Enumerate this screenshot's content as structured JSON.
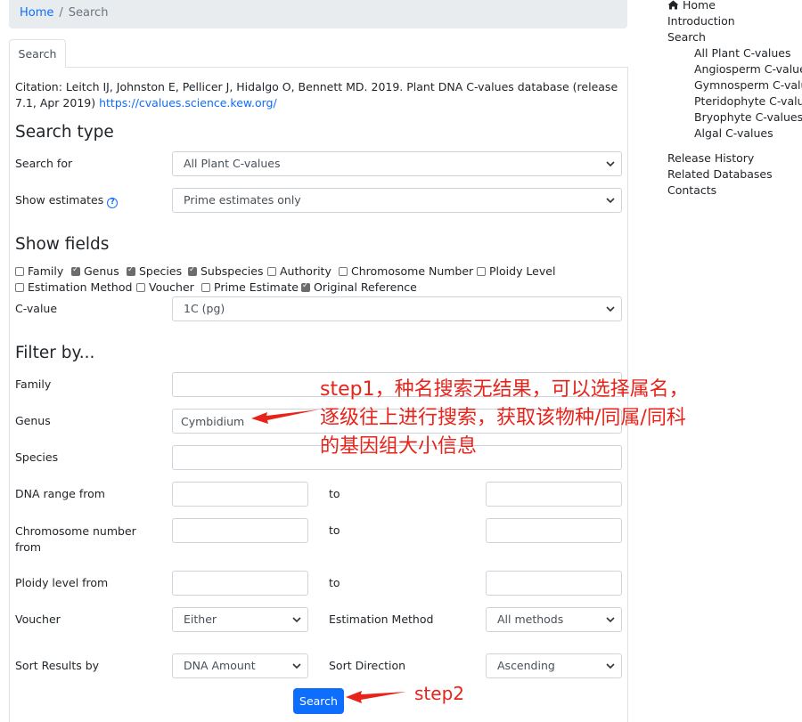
{
  "breadcrumb": {
    "home": "Home",
    "current": "Search"
  },
  "tab": {
    "label": "Search"
  },
  "citation": {
    "text": "Citation: Leitch IJ, Johnston E, Pellicer J, Hidalgo O, Bennett MD. 2019. Plant DNA C-values database (release 7.1, Apr 2019) ",
    "link": "https://cvalues.science.kew.org/"
  },
  "search_type": {
    "heading": "Search type",
    "search_for_label": "Search for",
    "search_for_value": "All Plant C-values",
    "show_estimates_label": "Show estimates",
    "show_estimates_help": "?",
    "show_estimates_value": "Prime estimates only"
  },
  "show_fields": {
    "heading": "Show fields",
    "checkboxes": [
      {
        "label": "Family",
        "checked": false
      },
      {
        "label": "Genus",
        "checked": true
      },
      {
        "label": "Species",
        "checked": true
      },
      {
        "label": "Subspecies",
        "checked": true
      },
      {
        "label": "Authority",
        "checked": false
      },
      {
        "label": "Chromosome Number",
        "checked": false
      },
      {
        "label": "Ploidy Level",
        "checked": false
      },
      {
        "label": "Estimation Method",
        "checked": false
      },
      {
        "label": "Voucher",
        "checked": false
      },
      {
        "label": "Prime Estimate",
        "checked": false
      },
      {
        "label": "Original Reference",
        "checked": true
      }
    ],
    "cvalue_label": "C-value",
    "cvalue_value": "1C (pg)"
  },
  "filter": {
    "heading": "Filter by...",
    "family_label": "Family",
    "family_value": "",
    "genus_label": "Genus",
    "genus_value": "Cymbidium",
    "species_label": "Species",
    "species_value": "",
    "dna_range_label": "DNA range from",
    "chrom_label_1": "Chromosome number",
    "chrom_label_2": "from",
    "ploidy_label": "Ploidy level from",
    "to_label": "to",
    "voucher_label": "Voucher",
    "voucher_value": "Either",
    "estimation_label": "Estimation Method",
    "estimation_value": "All methods",
    "sort_label": "Sort Results by",
    "sort_value": "DNA Amount",
    "direction_label": "Sort Direction",
    "direction_value": "Ascending",
    "search_button": "Search"
  },
  "sidebar": {
    "home": "Home",
    "introduction": "Introduction",
    "search": "Search",
    "sub_items": [
      "All Plant C-values",
      "Angiosperm C-values",
      "Gymnosperm C-value",
      "Pteridophyte C-value",
      "Bryophyte C-values",
      "Algal C-values"
    ],
    "release_history": "Release History",
    "related_databases": "Related Databases",
    "contacts": "Contacts"
  },
  "annotations": {
    "step1_line1": "step1，种名搜索无结果，可以选择属名，",
    "step1_line2": "逐级往上进行搜索，获取该物种/同属/同科",
    "step1_line3": "的基因组大小信息",
    "step2": "step2"
  },
  "colors": {
    "accent": "#0d6efd",
    "annotation": "#e8231a"
  }
}
